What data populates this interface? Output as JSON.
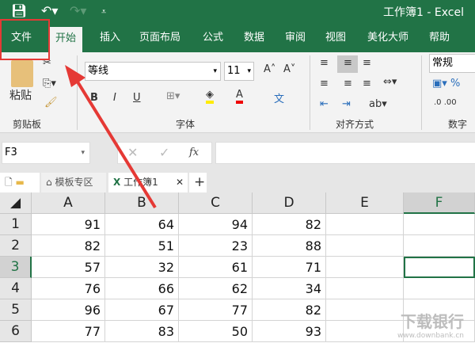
{
  "title": "工作簿1  -  Excel",
  "menu_tabs": [
    "文件",
    "开始",
    "插入",
    "页面布局",
    "公式",
    "数据",
    "审阅",
    "视图",
    "美化大师",
    "帮助"
  ],
  "ribbon": {
    "paste": "粘贴",
    "clipboard": "剪贴板",
    "font_name": "等线",
    "font_size": "11",
    "font_group": "字体",
    "bold": "B",
    "italic": "I",
    "underline": "U",
    "align_group": "对齐方式",
    "number_format": "常规",
    "number_group": "数字"
  },
  "formula": {
    "name_box": "F3",
    "fx": "fx",
    "value": ""
  },
  "doc_tabs": {
    "template": "模板专区",
    "workbook": "工作簿1",
    "add": "+"
  },
  "columns": [
    "A",
    "B",
    "C",
    "D",
    "E",
    "F"
  ],
  "rows": [
    {
      "n": "1",
      "v": [
        "91",
        "64",
        "94",
        "82"
      ]
    },
    {
      "n": "2",
      "v": [
        "82",
        "51",
        "23",
        "88"
      ]
    },
    {
      "n": "3",
      "v": [
        "57",
        "32",
        "61",
        "71"
      ]
    },
    {
      "n": "4",
      "v": [
        "76",
        "66",
        "62",
        "34"
      ]
    },
    {
      "n": "5",
      "v": [
        "96",
        "67",
        "77",
        "82"
      ]
    },
    {
      "n": "6",
      "v": [
        "77",
        "83",
        "50",
        "93"
      ]
    }
  ],
  "watermark": {
    "name": "下载银行",
    "url": "www.downbank.cn"
  },
  "colors": {
    "brand": "#217346",
    "annotation": "#e53935"
  }
}
